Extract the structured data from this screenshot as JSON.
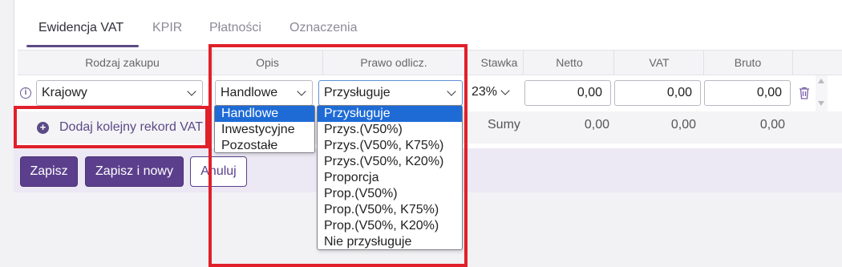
{
  "tabs": [
    {
      "label": "Ewidencja VAT",
      "active": true
    },
    {
      "label": "KPIR",
      "active": false
    },
    {
      "label": "Płatności",
      "active": false
    },
    {
      "label": "Oznaczenia",
      "active": false
    }
  ],
  "table": {
    "headers": {
      "rodzaj": "Rodzaj zakupu",
      "opis": "Opis",
      "prawo": "Prawo odlicz.",
      "stawka": "Stawka",
      "netto": "Netto",
      "vat": "VAT",
      "brutto": "Bruto"
    },
    "row": {
      "rodzaj": "Krajowy",
      "opis": "Handlowe",
      "prawo": "Przysługuje",
      "stawka": "23%",
      "netto": "0,00",
      "vat": "0,00",
      "brutto": "0,00"
    },
    "sums": {
      "label": "Sumy",
      "netto": "0,00",
      "vat": "0,00",
      "brutto": "0,00"
    },
    "add_record": "Dodaj kolejny rekord VAT"
  },
  "opis_options": [
    {
      "label": "Handlowe",
      "selected": true
    },
    {
      "label": "Inwestycyjne",
      "selected": false
    },
    {
      "label": "Pozostałe",
      "selected": false
    }
  ],
  "prawo_options": [
    {
      "label": "Przysługuje",
      "selected": true
    },
    {
      "label": "Przys.(V50%)",
      "selected": false
    },
    {
      "label": "Przys.(V50%, K75%)",
      "selected": false
    },
    {
      "label": "Przys.(V50%, K20%)",
      "selected": false
    },
    {
      "label": "Proporcja",
      "selected": false
    },
    {
      "label": "Prop.(V50%)",
      "selected": false
    },
    {
      "label": "Prop.(V50%, K75%)",
      "selected": false
    },
    {
      "label": "Prop.(V50%, K20%)",
      "selected": false
    },
    {
      "label": "Nie przysługuje",
      "selected": false
    }
  ],
  "buttons": {
    "save": "Zapisz",
    "save_new": "Zapisz i nowy",
    "cancel": "Anuluj"
  },
  "icons": {
    "info": "info-icon",
    "trash": "trash-icon",
    "plus": "plus-circle-icon"
  },
  "colors": {
    "accent": "#5b3f8c",
    "highlight": "#e0202a",
    "selected_option": "#1e6bd6"
  }
}
